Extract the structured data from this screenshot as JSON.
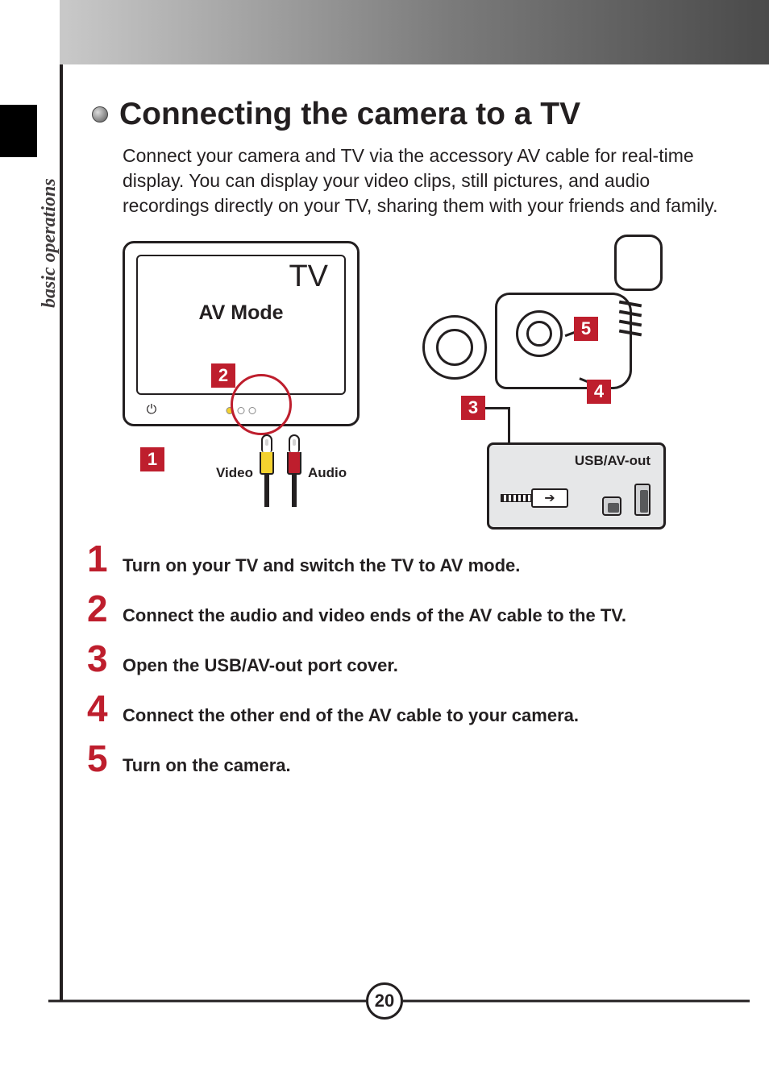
{
  "section_label": "basic operations",
  "title": "Connecting the camera to a TV",
  "intro": "Connect your camera and TV via the accessory AV cable for real-time display. You can display your video clips, still pictures, and audio recordings directly on your TV, sharing them with your friends and family.",
  "diagram": {
    "tv_label": "TV",
    "av_mode": "AV Mode",
    "video_label": "Video",
    "audio_label": "Audio",
    "port_title": "USB/AV-out",
    "callouts": {
      "c1": "1",
      "c2": "2",
      "c3": "3",
      "c4": "4",
      "c5": "5"
    }
  },
  "steps": [
    {
      "num": "1",
      "text": "Turn on your TV and switch the TV to AV mode."
    },
    {
      "num": "2",
      "text": "Connect the audio and video ends of the AV cable to the TV."
    },
    {
      "num": "3",
      "text": "Open the USB/AV-out port cover."
    },
    {
      "num": "4",
      "text": "Connect the other end of the AV cable to your camera."
    },
    {
      "num": "5",
      "text": "Turn on the camera."
    }
  ],
  "page_number": "20"
}
